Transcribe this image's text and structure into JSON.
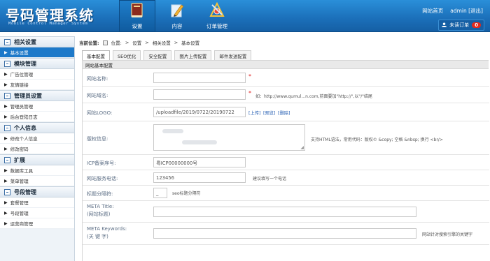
{
  "app": {
    "title": "号码管理系统",
    "subtitle": "Mobile Control Manager System"
  },
  "nav": [
    {
      "label": "设置",
      "icon": "book-icon",
      "active": true
    },
    {
      "label": "内容",
      "icon": "pencil-icon",
      "active": false
    },
    {
      "label": "订单管理",
      "icon": "tools-icon",
      "active": false
    }
  ],
  "toplinks": {
    "home": "网站首页",
    "admin": "admin [退出]"
  },
  "orders": {
    "label": "未读订单",
    "count": "0"
  },
  "sidebar": {
    "groups": [
      {
        "title": "相关设置",
        "items": [
          {
            "label": "基本设置",
            "active": true
          }
        ]
      },
      {
        "title": "模块管理",
        "items": [
          {
            "label": "广告位管理"
          },
          {
            "label": "友情链接"
          }
        ]
      },
      {
        "title": "管理员设置",
        "items": [
          {
            "label": "管理员管理"
          },
          {
            "label": "后台登陆日志"
          }
        ]
      },
      {
        "title": "个人信息",
        "items": [
          {
            "label": "修改个人信息"
          },
          {
            "label": "修改密码"
          }
        ]
      },
      {
        "title": "扩展",
        "items": [
          {
            "label": "数据库工具"
          },
          {
            "label": "菜单管理"
          }
        ]
      },
      {
        "title": "号段管理",
        "items": [
          {
            "label": "套餐管理"
          },
          {
            "label": "号段管理"
          },
          {
            "label": "运营商管理"
          }
        ]
      }
    ]
  },
  "breadcrumb": {
    "prefix": "当前位置:",
    "parts": [
      "位置:",
      "设置",
      "相关设置",
      "基本设置"
    ],
    "sep": ">"
  },
  "tabs": [
    "基本配置",
    "SEO优化",
    "安全配置",
    "图片上传配置",
    "邮件发送配置"
  ],
  "form": {
    "title": "网站基本配置",
    "site_name": {
      "label": "网站名称:",
      "value": "",
      "required": "*"
    },
    "site_domain": {
      "label": "网站域名:",
      "value": "",
      "required": "*",
      "hint": "如：http://www.qumul...n.com,前面要加\"http://\",以\"/\"结尾"
    },
    "logo": {
      "label": "网站LOGO:",
      "value": "/uploadfile/2019/0722/20190722",
      "upload": "[上传]",
      "preview": "[预览]",
      "delete": "[删除]"
    },
    "copyright": {
      "label": "版权信息:",
      "hint": "支持HTML语法，常用代码：版权© &copy; 空格 &nbsp; 换行 <br/>"
    },
    "icp": {
      "label": "ICP备案序号:",
      "value": "粤ICP00000000号"
    },
    "phone": {
      "label": "网站服务电话:",
      "value": "123456",
      "hint": "建议填写一个电话"
    },
    "separator": {
      "label": "标题分隔符:",
      "value": "_",
      "hint": "seo标题分隔符"
    },
    "meta_title": {
      "label": "META Title:",
      "label2": "(网站标题)",
      "value": ""
    },
    "meta_keywords": {
      "label": "META Keywords:",
      "label2": "(关 键 字)",
      "value": "",
      "hint": "网站针对搜索引擎的关键字"
    }
  },
  "colors": {
    "topbar": "#1b6fb9",
    "accent": "#1d79c9",
    "required": "#e02020",
    "badge": "#e4281b"
  }
}
